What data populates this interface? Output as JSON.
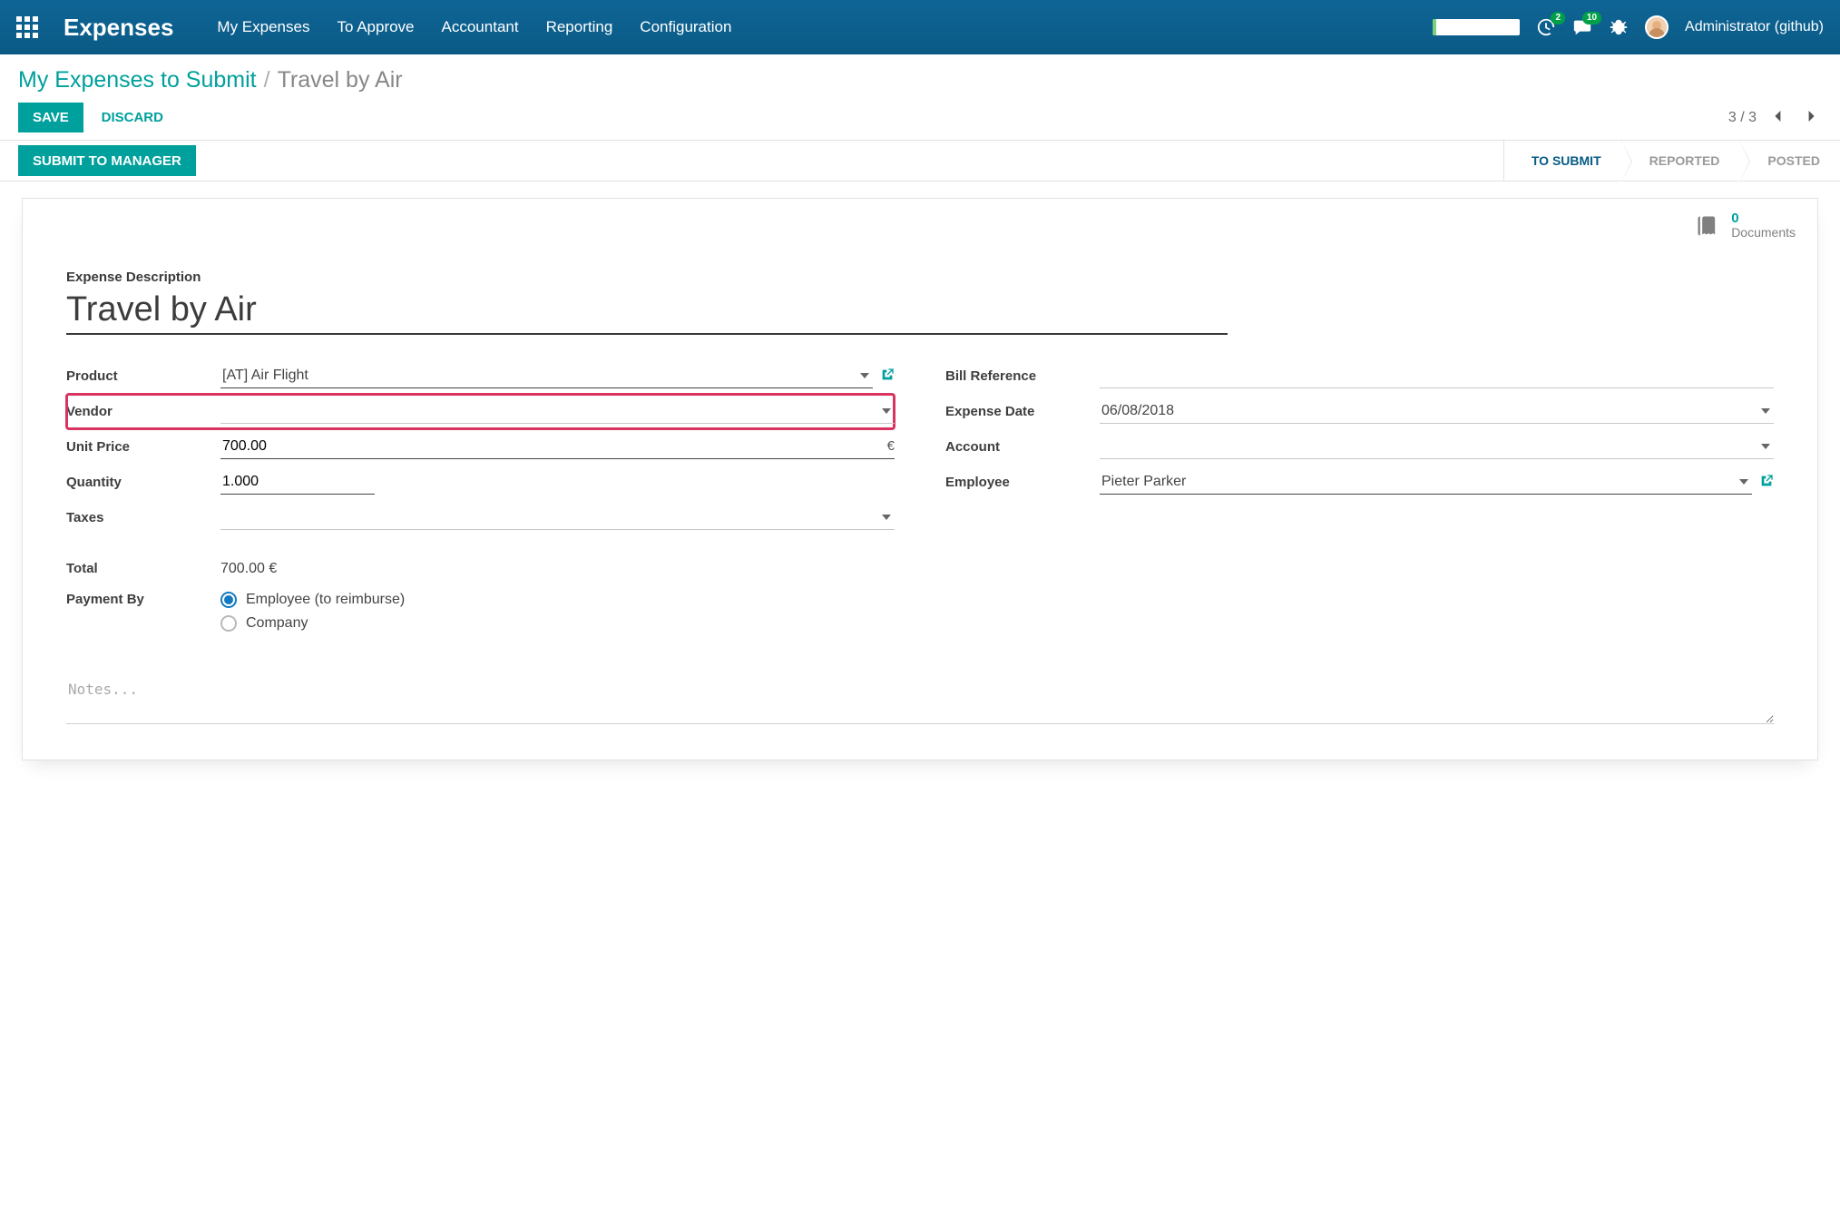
{
  "navbar": {
    "brand": "Expenses",
    "links": [
      "My Expenses",
      "To Approve",
      "Accountant",
      "Reporting",
      "Configuration"
    ],
    "badges": {
      "activities": "2",
      "messages": "10"
    },
    "user": "Administrator (github)"
  },
  "breadcrumb": {
    "link": "My Expenses to Submit",
    "sep": "/",
    "current": "Travel by Air"
  },
  "buttons": {
    "save": "Save",
    "discard": "Discard",
    "submit": "Submit to Manager"
  },
  "pager": {
    "text": "3 / 3"
  },
  "status_steps": [
    {
      "label": "To Submit",
      "active": true
    },
    {
      "label": "Reported",
      "active": false
    },
    {
      "label": "Posted",
      "active": false
    }
  ],
  "documents": {
    "count": "0",
    "label": "Documents"
  },
  "description": {
    "label": "Expense Description",
    "value": "Travel by Air"
  },
  "left_fields": {
    "product_label": "Product",
    "product_value": "[AT] Air Flight",
    "vendor_label": "Vendor",
    "vendor_value": "",
    "unit_price_label": "Unit Price",
    "unit_price_value": "700.00",
    "unit_price_currency": "€",
    "quantity_label": "Quantity",
    "quantity_value": "1.000",
    "taxes_label": "Taxes",
    "taxes_value": "",
    "total_label": "Total",
    "total_value": "700.00 €",
    "payment_label": "Payment By",
    "payment_opt1": "Employee (to reimburse)",
    "payment_opt2": "Company"
  },
  "right_fields": {
    "billref_label": "Bill Reference",
    "billref_value": "",
    "date_label": "Expense Date",
    "date_value": "06/08/2018",
    "account_label": "Account",
    "account_value": "",
    "employee_label": "Employee",
    "employee_value": "Pieter Parker"
  },
  "notes_placeholder": "Notes..."
}
